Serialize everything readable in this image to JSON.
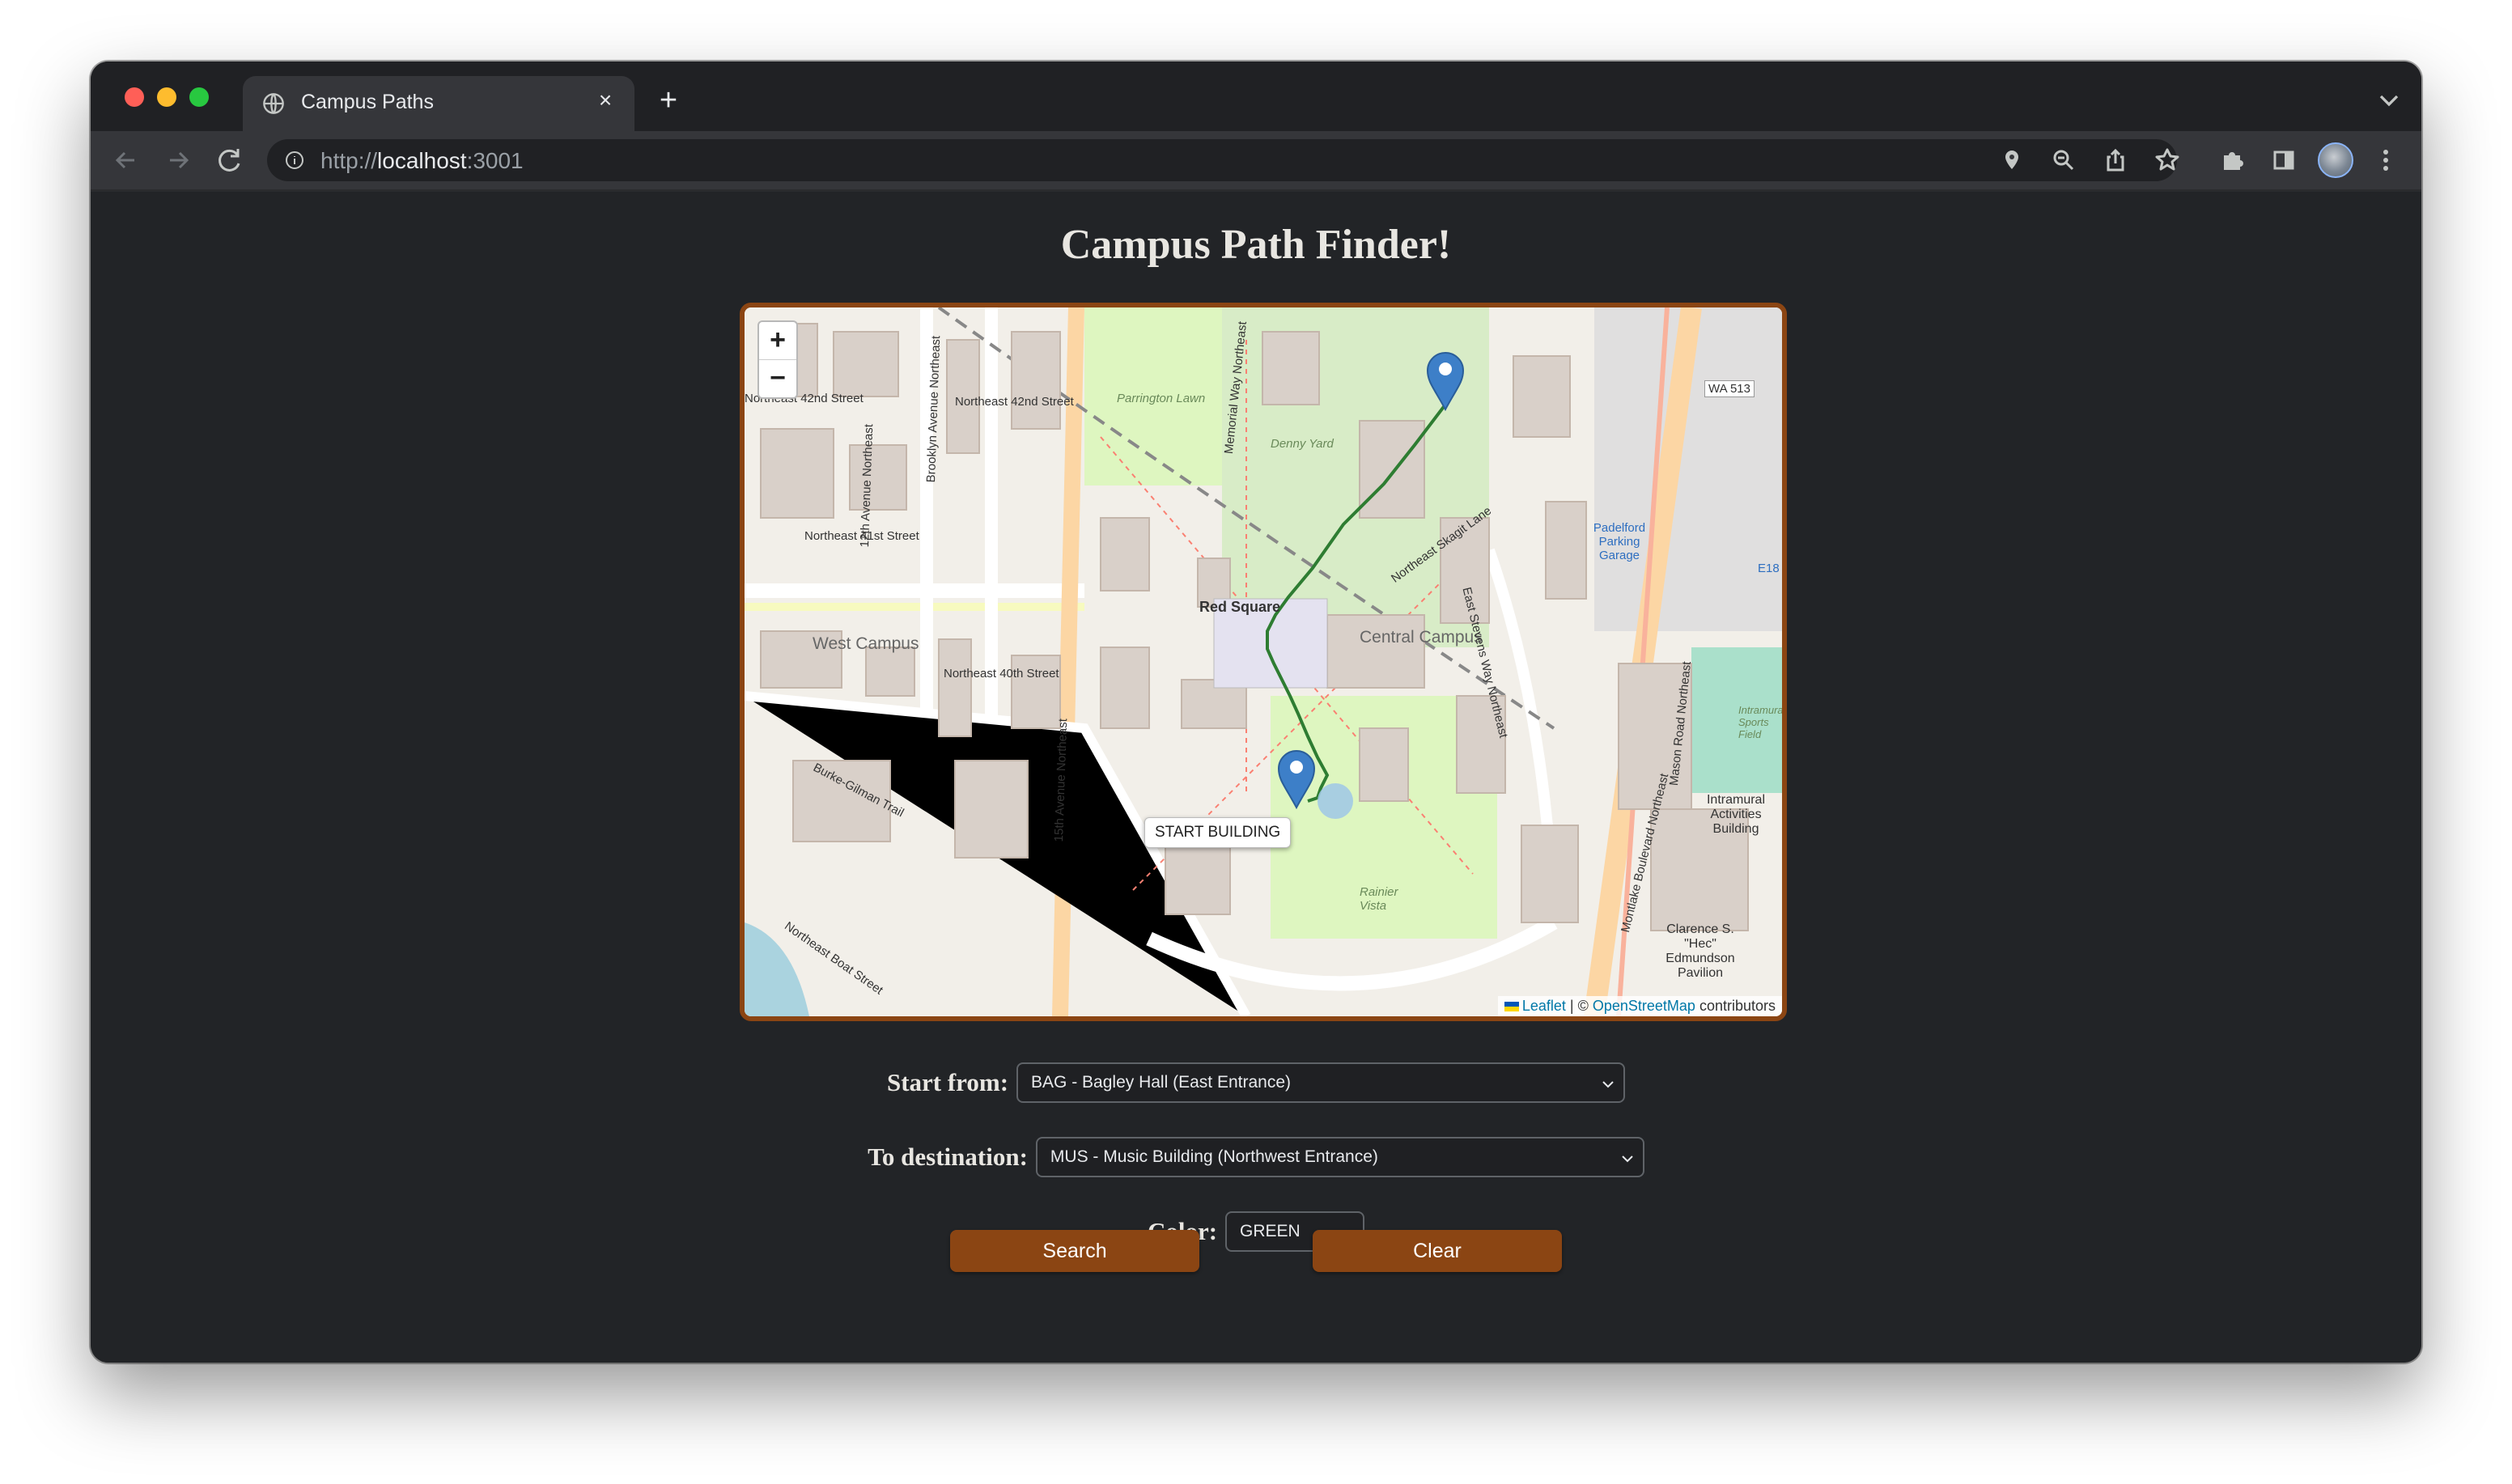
{
  "browser": {
    "tab_title": "Campus Paths",
    "url_scheme": "http://",
    "url_host": "localhost",
    "url_port": ":3001",
    "new_tab": "+",
    "tab_close": "×"
  },
  "page": {
    "title": "Campus Path Finder!"
  },
  "map": {
    "zoom_in": "+",
    "zoom_out": "−",
    "tooltip": "START BUILDING",
    "path_color": "#2e7d32",
    "attribution": {
      "leaflet": "Leaflet",
      "separator": " | © ",
      "osm": "OpenStreetMap",
      "contributors": " contributors"
    },
    "labels": {
      "red_square": "Red Square",
      "central_campus": "Central Campus",
      "west_campus": "West Campus",
      "ne_42nd_w": "Northeast 42nd Street",
      "ne_42nd_e": "Northeast 42nd Street",
      "ne_41st": "Northeast 41st Street",
      "ne_40th": "Northeast 40th Street",
      "parrington": "Parrington Lawn",
      "denny": "Denny Yard",
      "padelford": "Padelford Parking Garage",
      "wa513": "WA 513",
      "e18": "E18",
      "ima": "Intramural Activities Building",
      "clarence": "Clarence S. \"Hec\" Edmundson Pavilion",
      "rainier": "Rainier Vista",
      "burke_gilman": "Burke-Gilman Trail",
      "boat_street": "Northeast Boat Street",
      "ave_15th": "15th Avenue Northeast",
      "ave_12th": "12th Avenue Northeast",
      "brooklyn": "Brooklyn Avenue Northeast",
      "memorial": "Memorial Way Northeast",
      "montlake": "Montlake Boulevard Northeast",
      "mason": "Mason Road Northeast",
      "skagit": "Northeast Skagit Lane",
      "stevens": "East Stevens Way Northeast",
      "intramural_sports": "Intramural Sports Field"
    }
  },
  "controls": {
    "start_label": "Start from:",
    "start_value": "BAG - Bagley Hall (East Entrance)",
    "dest_label": "To destination:",
    "dest_value": "MUS - Music Building (Northwest Entrance)",
    "color_label": "Color:",
    "color_value": "GREEN",
    "search_label": "Search",
    "clear_label": "Clear"
  },
  "colors": {
    "accent": "#8b4513",
    "page_background": "#222427"
  }
}
